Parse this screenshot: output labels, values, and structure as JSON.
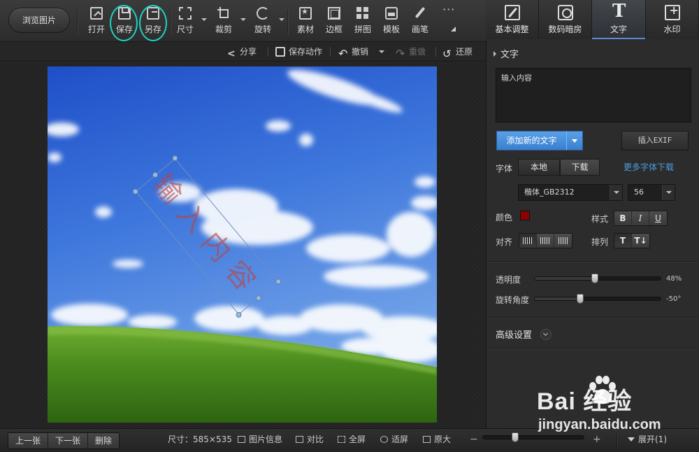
{
  "toolbar": {
    "browse_label": "浏览图片",
    "tools": {
      "open": "打开",
      "save": "保存",
      "save_as": "另存",
      "size": "尺寸",
      "crop": "裁剪",
      "rotate": "旋转",
      "material": "素材",
      "frame": "边框",
      "puzzle": "拼图",
      "template": "模板",
      "brush": "画笔"
    }
  },
  "tabs": {
    "basic": "基本调整",
    "darkroom": "数码暗房",
    "text": "文字",
    "watermark": "水印",
    "active": "text"
  },
  "subbar": {
    "share": "分享",
    "save_action": "保存动作",
    "undo": "撤销",
    "redo": "重做",
    "restore": "还原"
  },
  "canvas": {
    "overlay_text": "输入内容",
    "text_color": "#b84545",
    "text_rotation_deg": -50
  },
  "panel": {
    "title": "文字",
    "text_value": "输入内容",
    "add_text_label": "添加新的文字",
    "exif_label": "插入EXIF",
    "font_label": "字体",
    "source_local": "本地",
    "source_download": "下载",
    "more_fonts_link": "更多字体下载",
    "font_name": "楷体_GB2312",
    "font_size": "56",
    "color_label": "颜色",
    "color_value": "#8b0000",
    "style_label": "样式",
    "style_bold": "B",
    "style_italic": "I",
    "style_underline": "U",
    "align_label": "对齐",
    "arrange_label": "排列",
    "opacity_label": "透明度",
    "opacity_value": "48%",
    "opacity_percent": 48,
    "rotation_label": "旋转角度",
    "rotation_value": "-50°",
    "rotation_min": -180,
    "rotation_max": 180,
    "rotation_deg": -50,
    "advanced_label": "高级设置"
  },
  "bottombar": {
    "prev": "上一张",
    "next": "下一张",
    "delete": "删除",
    "size_text": "尺寸：585×535",
    "image_info": "图片信息",
    "compare": "对比",
    "fullscreen": "全屏",
    "fit_screen": "适屏",
    "original_size": "原大",
    "zoom_minus": "−",
    "zoom_plus": "+",
    "expand": "展开(1)"
  },
  "watermark": {
    "logo_text": "Bai  经验",
    "sub_text": "jingyan.baidu.com"
  }
}
